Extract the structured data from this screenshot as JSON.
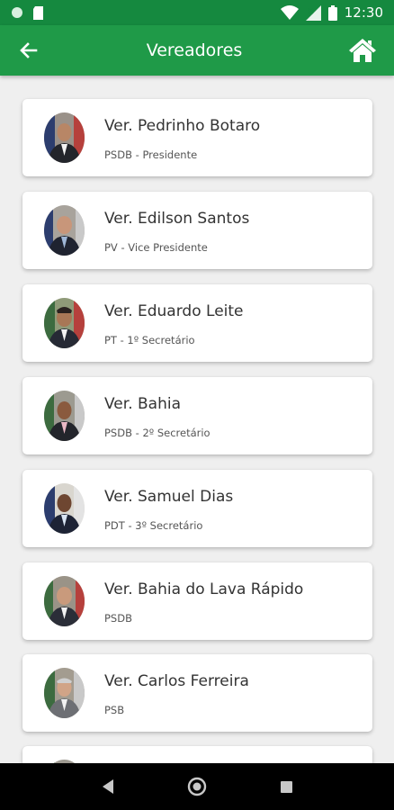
{
  "status_bar": {
    "time": "12:30",
    "icons": [
      "circle-notification-icon",
      "sd-card-icon",
      "wifi-icon",
      "signal-icon",
      "battery-icon"
    ]
  },
  "app_bar": {
    "title": "Vereadores",
    "back_icon": "arrow-left-icon",
    "home_icon": "home-icon",
    "color": "#1f9a48"
  },
  "members": [
    {
      "name": " Ver. Pedrinho Botaro",
      "role": "PSDB - Presidente"
    },
    {
      "name": "Ver. Edilson Santos",
      "role": "PV - Vice Presidente"
    },
    {
      "name": " Ver. Eduardo Leite",
      "role": "PT - 1º Secretário"
    },
    {
      "name": "Ver. Bahia",
      "role": "PSDB - 2º Secretário"
    },
    {
      "name": "Ver. Samuel Dias",
      "role": "PDT - 3º Secretário"
    },
    {
      "name": "Ver. Bahia do Lava Rápido",
      "role": "PSDB"
    },
    {
      "name": "Ver. Carlos Ferreira",
      "role": "PSB"
    },
    {
      "name": "",
      "role": ""
    }
  ],
  "nav_bar": {
    "icons": [
      "back-triangle-icon",
      "home-circle-icon",
      "recents-square-icon"
    ]
  }
}
